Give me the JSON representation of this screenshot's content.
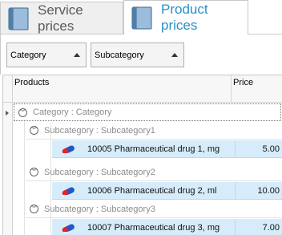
{
  "tabs": [
    {
      "label": "Service prices",
      "icon": "book-icon",
      "active": false
    },
    {
      "label": "Product prices",
      "icon": "book-icon",
      "active": true
    }
  ],
  "group_panel": {
    "buttons": [
      {
        "label": "Category"
      },
      {
        "label": "Subcategory"
      }
    ]
  },
  "grid": {
    "columns": {
      "products": "Products",
      "price": "Price"
    },
    "category_group": "Category : Category",
    "subgroups": [
      {
        "label": "Subcategory : Subcategory1",
        "row": {
          "code_name": "10005 Pharmaceutical drug 1, mg",
          "price": "5.00"
        }
      },
      {
        "label": "Subcategory : Subcategory2",
        "row": {
          "code_name": "10006 Pharmaceutical drug 2, ml",
          "price": "10.00"
        }
      },
      {
        "label": "Subcategory : Subcategory3",
        "row": {
          "code_name": "10007 Pharmaceutical drug 3, mg",
          "price": "7.00"
        }
      }
    ]
  },
  "colors": {
    "accent": "#2a8fc9",
    "row_highlight": "#d6ecfa",
    "pill_red": "#e0262c",
    "pill_blue": "#2356c9"
  }
}
